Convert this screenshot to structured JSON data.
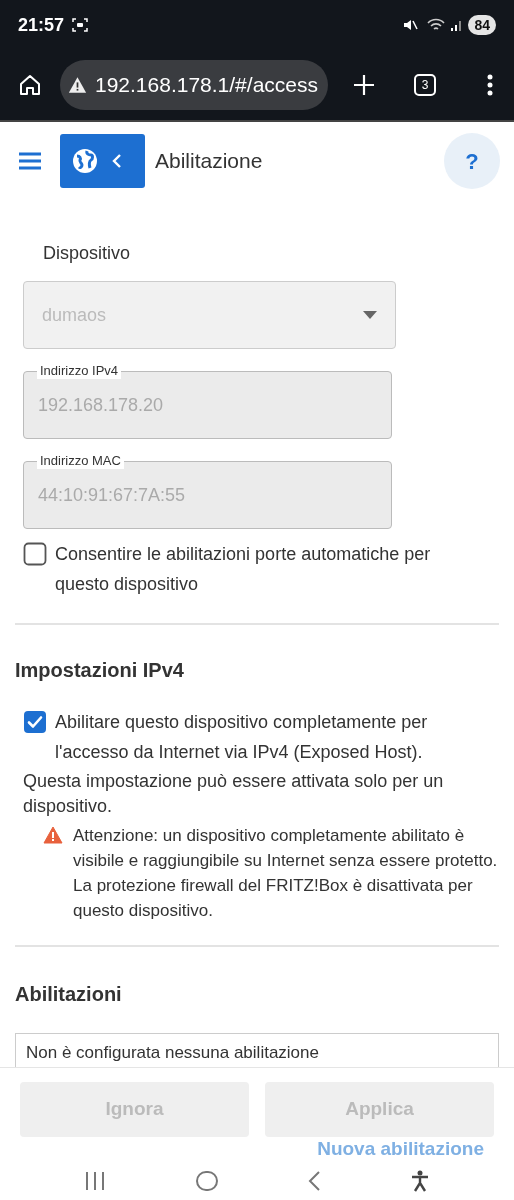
{
  "status_bar": {
    "time": "21:57",
    "battery": "84"
  },
  "browser": {
    "url": "192.168.178.1/#/access",
    "tab_count": "3"
  },
  "header": {
    "title": "Abilitazione",
    "help": "?"
  },
  "device": {
    "label": "Dispositivo",
    "value": "dumaos",
    "disabled": true
  },
  "fields": [
    {
      "label": "Indirizzo IPv4",
      "value": "192.168.178.20",
      "disabled": true
    },
    {
      "label": "Indirizzo MAC",
      "value": "44:10:91:67:7A:55",
      "disabled": true
    }
  ],
  "auto_ports": {
    "label": "Consentire le abilitazioni porte automatiche per questo dispositivo",
    "checked": false
  },
  "ipv4": {
    "heading": "Impostazioni IPv4",
    "exposed_host": {
      "label": "Abilitare questo dispositivo completamente per l'accesso da Internet via IPv4 (Exposed Host).",
      "checked": true
    },
    "note": "Questa impostazione può essere attivata solo per un dispositivo.",
    "warning": "Attenzione: un dispositivo completamente abilitato è visibile e raggiungibile su Internet senza essere protetto. La protezione firewall del FRITZ!Box è disattivata per questo dispositivo."
  },
  "releases": {
    "heading": "Abilitazioni",
    "empty": "Non è configurata nessuna abilitazione"
  },
  "buttons": [
    {
      "label": "Ignora",
      "disabled": true
    },
    {
      "label": "Applica",
      "disabled": true
    }
  ],
  "new_release": "Nuova abilitazione"
}
